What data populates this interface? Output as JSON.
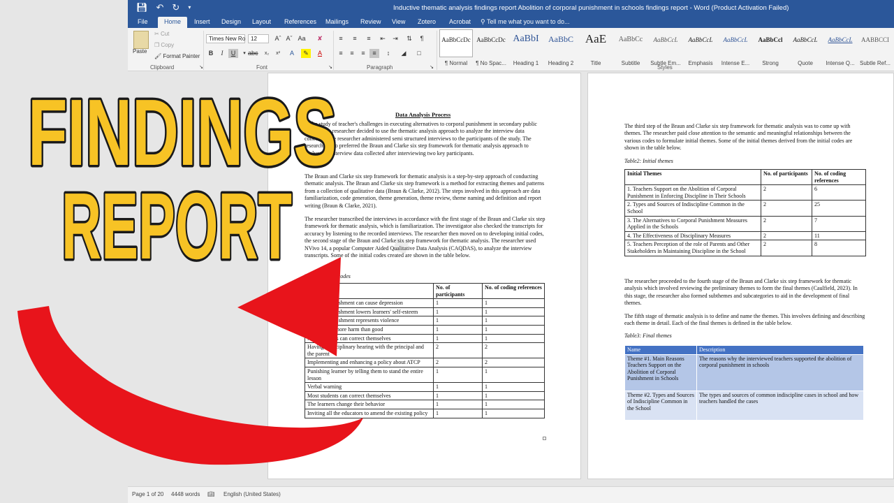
{
  "window": {
    "title": "Inductive thematic analysis  findings report Abolition of corporal punishment in schools  findings report - Word (Product Activation Failed)",
    "qat": {
      "save_icon": "save-icon",
      "undo_icon": "undo-icon",
      "redo_icon": "redo-icon"
    }
  },
  "tabs": [
    "File",
    "Home",
    "Insert",
    "Design",
    "Layout",
    "References",
    "Mailings",
    "Review",
    "View",
    "Zotero",
    "Acrobat"
  ],
  "tell_me": "Tell me what you want to do...",
  "ribbon": {
    "clipboard": {
      "paste": "Paste",
      "cut": "Cut",
      "copy": "Copy",
      "format_painter": "Format Painter",
      "label": "Clipboard"
    },
    "font": {
      "name": "Times New Ro",
      "size": "12",
      "label": "Font",
      "bold": "B",
      "italic": "I",
      "underline": "U"
    },
    "paragraph": {
      "label": "Paragraph"
    },
    "styles": {
      "label": "Styles",
      "items": [
        {
          "preview": "AaBbCcDc",
          "name": "¶ Normal"
        },
        {
          "preview": "AaBbCcDc",
          "name": "¶ No Spac..."
        },
        {
          "preview": "AaBbI",
          "name": "Heading 1"
        },
        {
          "preview": "AaBbC",
          "name": "Heading 2"
        },
        {
          "preview": "AaE",
          "name": "Title"
        },
        {
          "preview": "AaBbCc",
          "name": "Subtitle"
        },
        {
          "preview": "AaBbCcL",
          "name": "Subtle Em..."
        },
        {
          "preview": "AaBbCcL",
          "name": "Emphasis"
        },
        {
          "preview": "AaBbCcL",
          "name": "Intense E..."
        },
        {
          "preview": "AaBbCcl",
          "name": "Strong"
        },
        {
          "preview": "AaBbCcL",
          "name": "Quote"
        },
        {
          "preview": "AaBbCcL",
          "name": "Intense Q..."
        },
        {
          "preview": "AABBCCI",
          "name": "Subtle Ref..."
        }
      ]
    }
  },
  "page1": {
    "heading": "Data Analysis Process",
    "paragraphs": [
      "In the study of teacher's challenges in executing alternatives to corporal punishment in secondary public schools, the researcher decided to use the thematic analysis approach to analyze the interview data collected. The researcher administered semi structured interviews to the participants of the study. The researcher also preferred the Braun and Clarke six step framework for thematic analysis approach to analyze the interview data collected after interviewing two key participants.",
      "The Braun and Clarke six step framework for thematic analysis is a step-by-step approach of conducting thematic analysis. The Braun and Clarke six step framework is a method for extracting themes and patterns from a collection of qualitative data (Braun & Clarke, 2012). The steps involved in this approach are data familiarization, code generation, theme generation, theme review, theme naming and definition and report writing (Braun & Clarke, 2021).",
      "The researcher transcribed the interviews in accordance with the first stage of the Braun and Clarke six step framework for thematic analysis, which is familiarization. The investigator also checked the transcripts for accuracy by listening to the recorded interviews. The researcher then moved on to developing initial codes, the second stage of the Braun and Clarke six step framework for thematic analysis. The researcher used NVivo 14, a popular Computer Aided Qualitative Data Analysis (CAQDAS), to analyze the interview transcripts. Some of the initial codes created are shown in the table below."
    ],
    "table_caption": "Table1: Initial codes",
    "table_headers": [
      "Initial Codes",
      "No. of participants",
      "No. of coding references"
    ],
    "table_rows": [
      [
        "Corporal punishment can cause depression",
        "1",
        "1"
      ],
      [
        "Corporal punishment lowers learners' self-esteem",
        "1",
        "1"
      ],
      [
        "Corporal punishment represents violence",
        "1",
        "1"
      ],
      [
        "It can cause more harm than good",
        "1",
        "1"
      ],
      [
        "Most students can correct themselves",
        "1",
        "1"
      ],
      [
        "Having a disciplinary hearing with the principal and the parent",
        "2",
        "2"
      ],
      [
        "Implementing and enhancing a policy about ATCP",
        "2",
        "2"
      ],
      [
        "Punishing learner by telling them to stand the entire lesson",
        "1",
        "1"
      ],
      [
        "Verbal warning",
        "1",
        "1"
      ],
      [
        "Most students can correct themselves",
        "1",
        "1"
      ],
      [
        "The learners change their behavior",
        "1",
        "1"
      ],
      [
        "Inviting all the educators to amend the existing policy",
        "1",
        "1"
      ]
    ]
  },
  "page2": {
    "paragraph1": "The third step of the Braun and Clarke six step framework for thematic analysis was to come up with themes. The researcher paid close attention to the semantic and meaningful relationships between the various codes to formulate initial themes. Some of the initial themes derived from the initial codes are shown in the table below.",
    "table2_caption": "Table2: Initial themes",
    "table2_headers": [
      "Initial Themes",
      "No. of participants",
      "No. of coding references"
    ],
    "table2_rows": [
      [
        "1. Teachers Support on the Abolition of Corporal Punishment in Enforcing Discipline in Their Schools",
        "2",
        "6"
      ],
      [
        "2. Types and Sources of Indiscipline Common in the School",
        "2",
        "25"
      ],
      [
        "3. The Alternatives to Corporal Punishment Measures Applied in the Schools",
        "2",
        "7"
      ],
      [
        "4. The Effectiveness of Disciplinary Measures",
        "2",
        "11"
      ],
      [
        "5. Teachers Perception of the role of Parents and Other Stakeholders in Maintaining Discipline in the School",
        "2",
        "8"
      ]
    ],
    "paragraph2": "The researcher proceeded to the fourth stage of the Braun and Clarke six step framework for thematic analysis which involved reviewing the preliminary themes to form the final themes (Caulfield, 2023). In this stage, the researcher also formed subthemes and subcategories to aid in the development of final themes.",
    "paragraph3": "The fifth stage of thematic analysis is to define and name the themes. This involves defining and describing each theme in detail. Each of the final themes is defined in the table below.",
    "table3_caption": "Table3: Final themes",
    "table3_headers": [
      "Name",
      "Description"
    ],
    "table3_rows": [
      [
        "Theme #1. Main Reasons Teachers Support on the Abolition of Corporal Punishment in Schools",
        "The reasons why the interviewed teachers supported the abolition of corporal punishment in schools"
      ],
      [
        "Theme #2. Types and Sources of Indiscipline Common in the School",
        "The types and sources of common indiscipline cases in school and how teachers handled the cases"
      ]
    ]
  },
  "status": {
    "page": "Page 1 of 20",
    "words": "4448 words",
    "language": "English (United States)"
  },
  "overlay": {
    "line1": "FINDINGS",
    "line2": "REPORT",
    "text_color": "#f7c325",
    "outline_color": "#1a1a1a",
    "arrow_color": "#e8141b"
  }
}
